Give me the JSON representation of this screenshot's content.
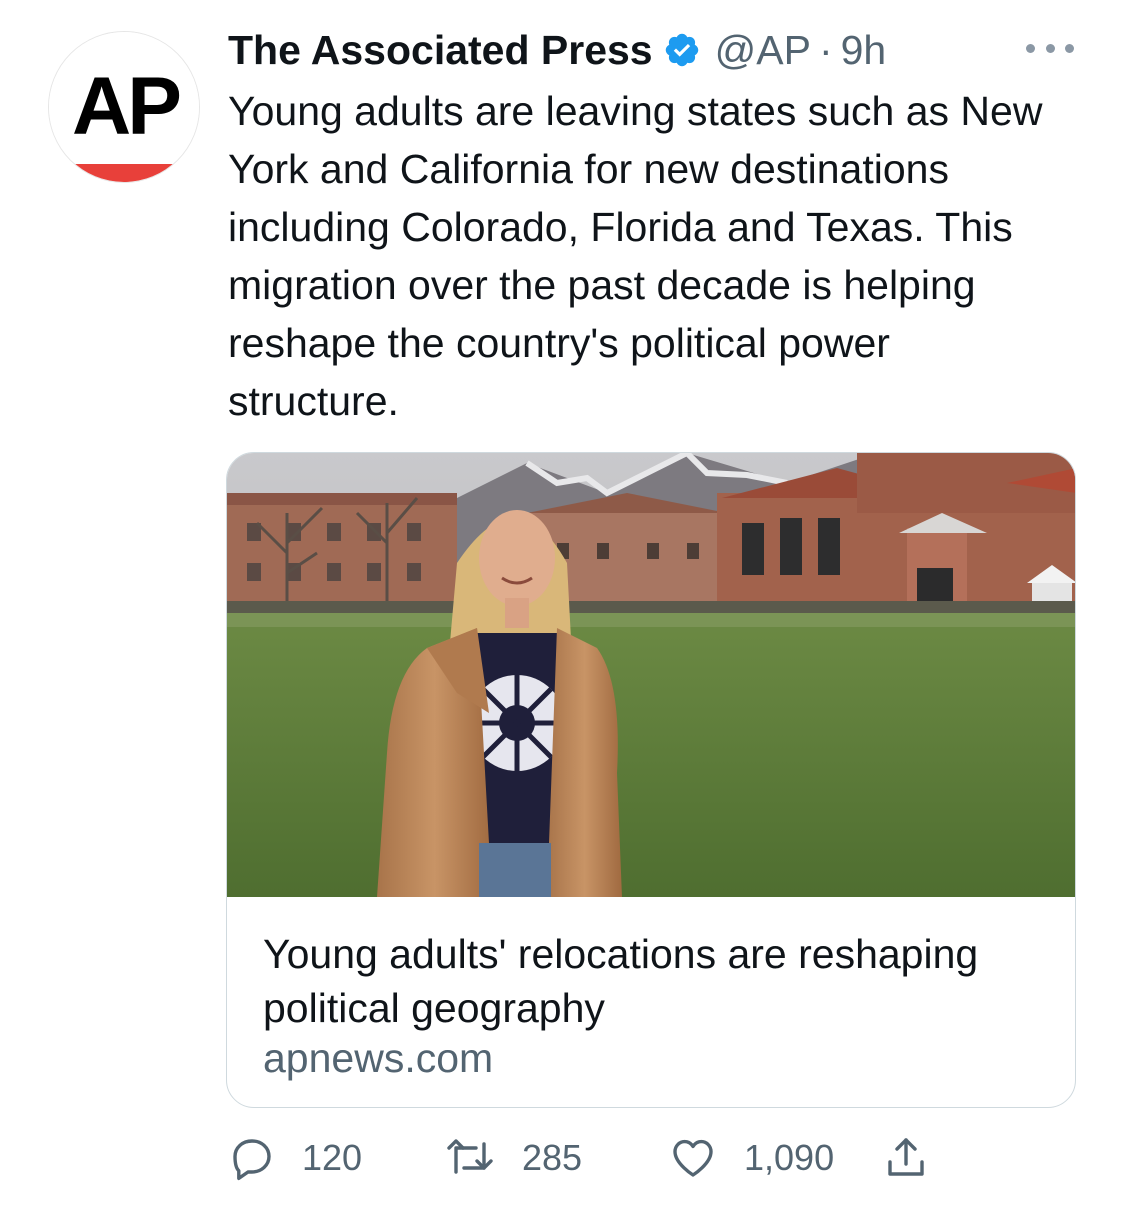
{
  "author": {
    "display_name": "The Associated Press",
    "handle": "@AP",
    "separator": "·",
    "time": "9h",
    "verified": true,
    "avatar_logo_text": "AP"
  },
  "tweet": {
    "text": "Young adults are leaving states such as New York and California for new destinations including Colorado, Florida and Texas. This migration over the past decade is helping reshape the country's political power structure."
  },
  "card": {
    "title": "Young adults' relocations are reshaping political geography",
    "domain": "apnews.com"
  },
  "actions": {
    "replies": "120",
    "retweets": "285",
    "likes": "1,090"
  },
  "colors": {
    "verified_badge": "#1d9bf0",
    "secondary_text": "#536471",
    "card_border": "#cfd9de",
    "ap_red": "#e8403a"
  },
  "icons": [
    "verified-icon",
    "more-icon",
    "reply-icon",
    "retweet-icon",
    "like-icon",
    "share-icon"
  ]
}
